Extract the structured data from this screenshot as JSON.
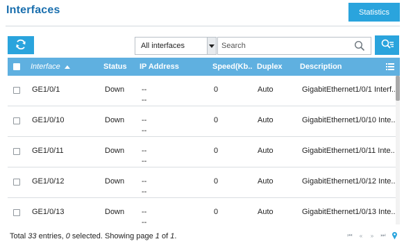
{
  "header": {
    "title": "Interfaces",
    "statistics_label": "Statistics"
  },
  "toolbar": {
    "refresh_icon": "refresh-icon",
    "filter_value": "All interfaces",
    "search_placeholder": "Search",
    "search_icon": "search-icon",
    "advanced_search_icon": "advanced-search-icon"
  },
  "colors": {
    "accent": "#2aa4dd",
    "table_header": "#5fb0e0",
    "title": "#1a6fae"
  },
  "table": {
    "columns": {
      "interface": "Interface",
      "status": "Status",
      "ip": "IP Address",
      "speed": "Speed(Kb...",
      "duplex": "Duplex",
      "description": "Description"
    },
    "column_menu_icon": "list-icon",
    "rows": [
      {
        "interface": "GE1/0/1",
        "status": "Down",
        "ip1": "--",
        "ip2": "--",
        "speed": "0",
        "duplex": "Auto",
        "description": "GigabitEthernet1/0/1 Interf..."
      },
      {
        "interface": "GE1/0/10",
        "status": "Down",
        "ip1": "--",
        "ip2": "--",
        "speed": "0",
        "duplex": "Auto",
        "description": "GigabitEthernet1/0/10 Inte..."
      },
      {
        "interface": "GE1/0/11",
        "status": "Down",
        "ip1": "--",
        "ip2": "--",
        "speed": "0",
        "duplex": "Auto",
        "description": "GigabitEthernet1/0/11 Inte..."
      },
      {
        "interface": "GE1/0/12",
        "status": "Down",
        "ip1": "--",
        "ip2": "--",
        "speed": "0",
        "duplex": "Auto",
        "description": "GigabitEthernet1/0/12 Inte..."
      },
      {
        "interface": "GE1/0/13",
        "status": "Down",
        "ip1": "--",
        "ip2": "--",
        "speed": "0",
        "duplex": "Auto",
        "description": "GigabitEthernet1/0/13 Inte..."
      }
    ]
  },
  "footer": {
    "prefix": "Total ",
    "total": "33",
    "entries_text": " entries, ",
    "selected": "0",
    "selected_text": " selected. Showing page ",
    "page": "1",
    "of_text": " of ",
    "pages": "1",
    "end_text": "."
  },
  "pager": {
    "first_label": "⏮",
    "prev_label": "«",
    "next_label": "»",
    "last_label": "⏭",
    "locate_icon": "pin-icon"
  }
}
